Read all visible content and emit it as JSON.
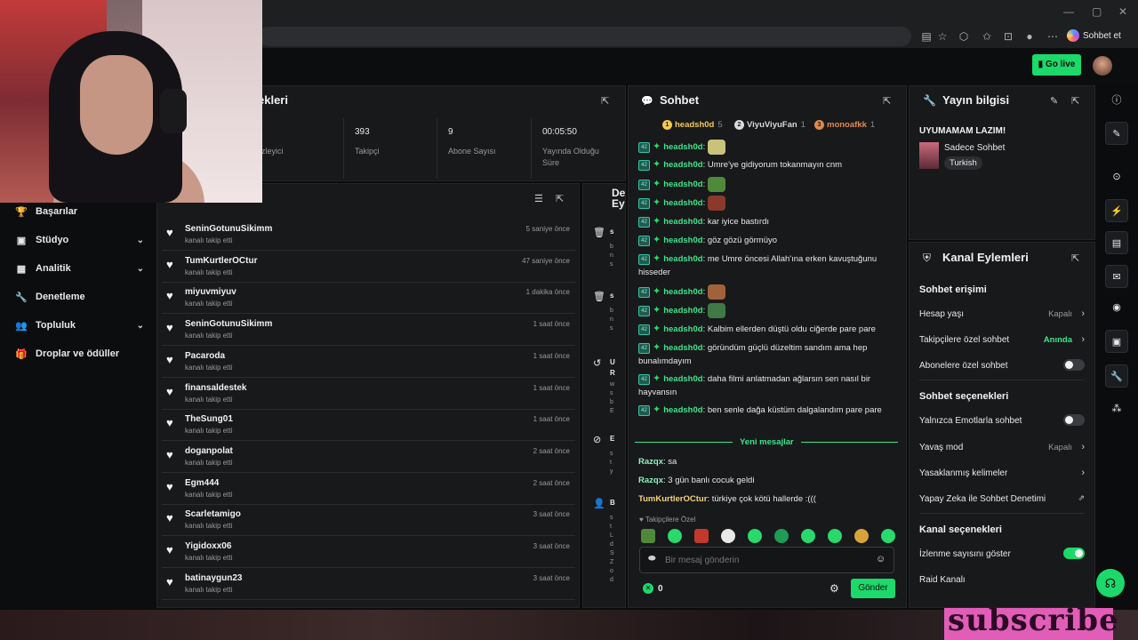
{
  "browser": {
    "sidebar_chat_label": "Sohbet et",
    "window_min": "—",
    "window_max": "▢",
    "window_close": "✕"
  },
  "appbar": {
    "go_live_label": "Go live"
  },
  "sidebar": {
    "items": [
      {
        "label": "Başarılar",
        "icon": "🏆",
        "chevron": ""
      },
      {
        "label": "Stüdyo",
        "icon": "▣",
        "chevron": "⌄"
      },
      {
        "label": "Analitik",
        "icon": "▦",
        "chevron": "⌄"
      },
      {
        "label": "Denetleme",
        "icon": "🔧",
        "chevron": ""
      },
      {
        "label": "Topluluk",
        "icon": "👥",
        "chevron": "⌄"
      },
      {
        "label": "Droplar ve ödüller",
        "icon": "🎁",
        "chevron": ""
      }
    ]
  },
  "stats": {
    "title_partial": "ekleri",
    "cells": [
      {
        "value": "",
        "label": "zleyici"
      },
      {
        "value": "393",
        "label": "Takipçi"
      },
      {
        "value": "9",
        "label": "Abone Sayısı"
      },
      {
        "value": "00:05:50",
        "label": "Yayında Olduğu Süre"
      }
    ]
  },
  "feed": {
    "rows": [
      {
        "user": "SeninGotunuSikimm",
        "action": "kanalı takip etti",
        "time": "5 saniye önce"
      },
      {
        "user": "TumKurtlerOCtur",
        "action": "kanalı takip etti",
        "time": "47 saniye önce"
      },
      {
        "user": "miyuvmiyuv",
        "action": "kanalı takip etti",
        "time": "1 dakika önce"
      },
      {
        "user": "SeninGotunuSikimm",
        "action": "kanalı takip etti",
        "time": "1 saat önce"
      },
      {
        "user": "Pacaroda",
        "action": "kanalı takip etti",
        "time": "1 saat önce"
      },
      {
        "user": "finansaldestek",
        "action": "kanalı takip etti",
        "time": "1 saat önce"
      },
      {
        "user": "TheSung01",
        "action": "kanalı takip etti",
        "time": "1 saat önce"
      },
      {
        "user": "doganpolat",
        "action": "kanalı takip etti",
        "time": "2 saat önce"
      },
      {
        "user": "Egm444",
        "action": "kanalı takip etti",
        "time": "2 saat önce"
      },
      {
        "user": "Scarletamigo",
        "action": "kanalı takip etti",
        "time": "3 saat önce"
      },
      {
        "user": "Yigidoxx06",
        "action": "kanalı takip etti",
        "time": "3 saat önce"
      },
      {
        "user": "batinaygun23",
        "action": "kanalı takip etti",
        "time": "3 saat önce"
      }
    ]
  },
  "mod": {
    "title_line1": "De",
    "title_line2": "Ey",
    "rows": [
      {
        "icon": "🗑",
        "title": "s",
        "sub": "b\nn\ns"
      },
      {
        "icon": "🗑",
        "title": "s",
        "sub": "b\nn\ns"
      },
      {
        "icon": "↺",
        "title": "U\nR",
        "sub": "w\ns\nb\nE"
      },
      {
        "icon": "⊘",
        "title": "E",
        "sub": "s\nt\ny"
      },
      {
        "icon": "👤",
        "title": "B",
        "sub": "s\nt\nL\nd\nS\nZ\no\nd"
      }
    ]
  },
  "chat": {
    "title": "Sohbet",
    "top_chatters": [
      {
        "rank": "1",
        "name": "headsh0d",
        "count": "5",
        "color": "#f2c94c"
      },
      {
        "rank": "2",
        "name": "ViyuViyuFan",
        "count": "1",
        "color": "#d9d9d9"
      },
      {
        "rank": "3",
        "name": "monoafkk",
        "count": "1",
        "color": "#e08a4a"
      }
    ],
    "badge_text": "42",
    "messages": [
      {
        "user": "headsh0d",
        "text": "",
        "emote": "#c9c27a"
      },
      {
        "user": "headsh0d",
        "text": "Umre'ye gidiyorum tokanmayın cnm",
        "emote": ""
      },
      {
        "user": "headsh0d",
        "text": "",
        "emote": "#4f8a3b"
      },
      {
        "user": "headsh0d",
        "text": "",
        "emote": "#8a3a2a"
      },
      {
        "user": "headsh0d",
        "text": "kar iyice bastırdı",
        "emote": ""
      },
      {
        "user": "headsh0d",
        "text": "göz gözü görmüyo",
        "emote": ""
      },
      {
        "user": "headsh0d",
        "text": "me Umre öncesi Allah'ına erken kavuştuğunu hisseder",
        "emote": ""
      },
      {
        "user": "headsh0d",
        "text": "",
        "emote": "#a0623a"
      },
      {
        "user": "headsh0d",
        "text": "",
        "emote": "#3f7a45"
      },
      {
        "user": "headsh0d",
        "text": "Kalbim ellerden düştü oldu ciğerde pare pare",
        "emote": ""
      },
      {
        "user": "headsh0d",
        "text": "göründüm güçlü düzeltim sandım ama hep bunalımdayım",
        "emote": ""
      },
      {
        "user": "headsh0d",
        "text": "daha filmi anlatmadan ağlarsın sen nasıl bir hayvansın",
        "emote": ""
      },
      {
        "user": "headsh0d",
        "text": "ben senle dağa küstüm dalgalandım pare pare",
        "emote": ""
      }
    ],
    "new_messages_label": "Yeni mesajlar",
    "new_messages": [
      {
        "user": "Razqx",
        "text": "sa",
        "color": "#8ef0bd"
      },
      {
        "user": "Razqx",
        "text": "3 gün banlı cocuk geldi",
        "color": "#8ef0bd"
      },
      {
        "user": "TumKurtlerOCtur",
        "text": "türkiye çok kötü hallerde :(((",
        "color": "#f2d477"
      }
    ],
    "followers_only_label": "Takipçilere Özel",
    "input_placeholder": "Bir mesaj gönderin",
    "points": "0",
    "send_label": "Gönder"
  },
  "stream_info": {
    "title": "Yayın bilgisi",
    "stream_title": "UYUMAMAM LAZIM!",
    "category": "Sadece Sohbet",
    "tag": "Turkish"
  },
  "channel_actions": {
    "title": "Kanal Eylemleri",
    "chat_access_header": "Sohbet erişimi",
    "account_age_label": "Hesap yaşı",
    "account_age_value": "Kapalı",
    "followers_chat_label": "Takipçilere özel sohbet",
    "followers_chat_value": "Anında",
    "subs_chat_label": "Abonelere özel sohbet",
    "chat_options_header": "Sohbet seçenekleri",
    "emote_only_label": "Yalnızca Emotlarla sohbet",
    "slow_mode_label": "Yavaş mod",
    "slow_mode_value": "Kapalı",
    "banned_words_label": "Yasaklanmış kelimeler",
    "ai_moderation_label": "Yapay Zeka ile Sohbet Denetimi",
    "channel_options_header": "Kanal seçenekleri",
    "show_viewers_label": "İzlenme sayısını göster",
    "raid_label": "Raid Kanalı"
  },
  "overlay": {
    "subscribe_text": "subscribe"
  },
  "colors": {
    "accent": "#1bd96a",
    "panel": "#18191b",
    "background": "#0b0c0d"
  }
}
